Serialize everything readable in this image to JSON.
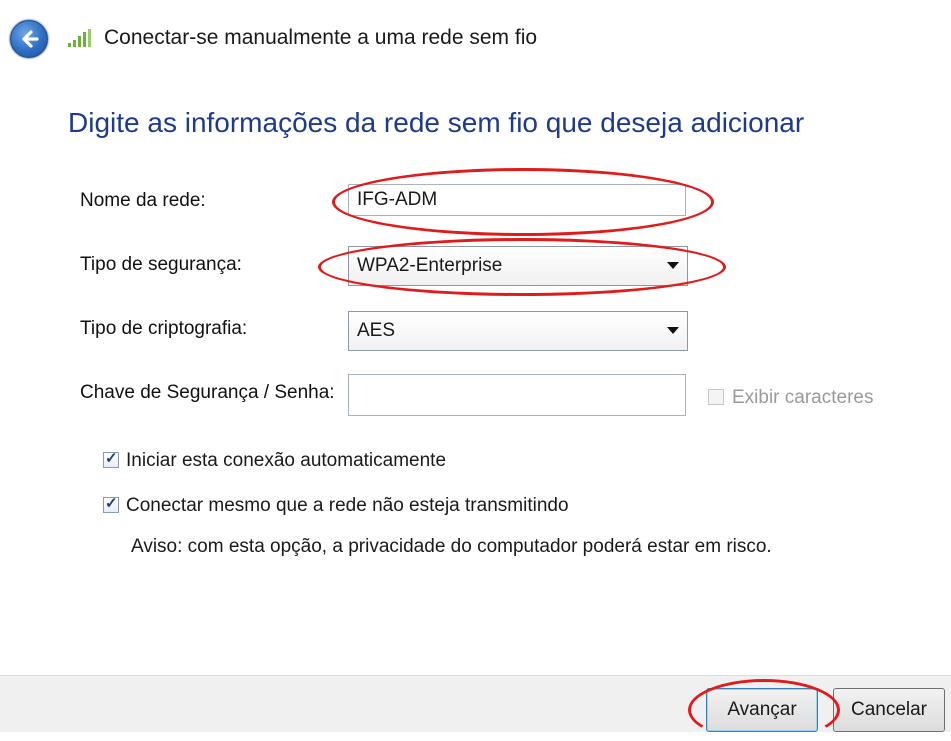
{
  "window": {
    "title": "Conectar-se manualmente a uma rede sem fio",
    "back_icon": "back-arrow-icon",
    "network_icon": "wifi-signal-icon"
  },
  "heading": "Digite as informações da rede sem fio que deseja adicionar",
  "form": {
    "network_name": {
      "label": "Nome da rede:",
      "value": "IFG-ADM"
    },
    "security_type": {
      "label": "Tipo de segurança:",
      "value": "WPA2-Enterprise"
    },
    "encryption_type": {
      "label": "Tipo de criptografia:",
      "value": "AES"
    },
    "security_key": {
      "label": "Chave de Segurança / Senha:",
      "value": "",
      "show_chars_label": "Exibir caracteres"
    }
  },
  "options": {
    "auto_start": {
      "label": "Iniciar esta conexão automaticamente",
      "checked": true
    },
    "connect_hidden": {
      "label": "Conectar mesmo que a rede não esteja transmitindo",
      "checked": true
    },
    "warning": "Aviso: com esta opção, a privacidade do computador poderá estar em risco."
  },
  "buttons": {
    "next": "Avançar",
    "cancel": "Cancelar"
  },
  "colors": {
    "heading": "#1e3a8a",
    "annotation": "#e01b1b"
  }
}
